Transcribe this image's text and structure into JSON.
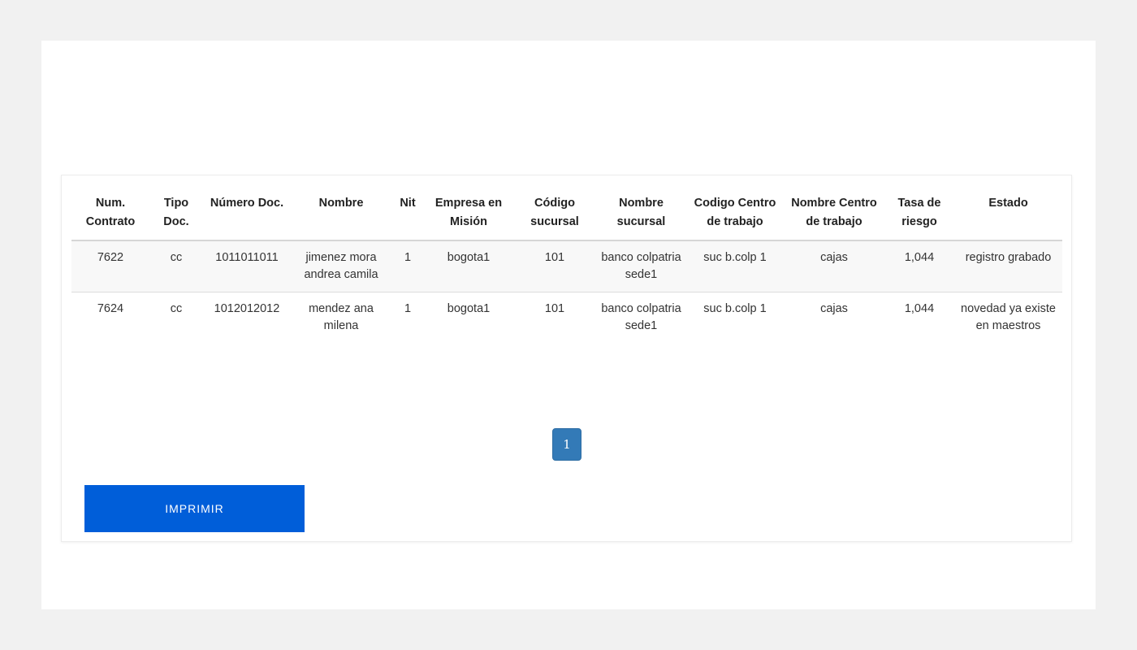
{
  "table": {
    "headers": [
      "Num. Contrato",
      "Tipo Doc.",
      "Número Doc.",
      "Nombre",
      "Nit",
      "Empresa en Misión",
      "Código sucursal",
      "Nombre sucursal",
      "Codigo Centro de trabajo",
      "Nombre Centro de trabajo",
      "Tasa de riesgo",
      "Estado"
    ],
    "rows": [
      [
        "7622",
        "cc",
        "1011011011",
        "jimenez mora andrea camila",
        "1",
        "bogota1",
        "101",
        "banco colpatria sede1",
        "suc b.colp 1",
        "cajas",
        "1,044",
        "registro grabado"
      ],
      [
        "7624",
        "cc",
        "1012012012",
        "mendez ana milena",
        "1",
        "bogota1",
        "101",
        "banco colpatria sede1",
        "suc b.colp 1",
        "cajas",
        "1,044",
        "novedad ya existe en maestros"
      ]
    ]
  },
  "pagination": {
    "current_page": "1"
  },
  "actions": {
    "print_label": "IMPRIMIR"
  },
  "colors": {
    "primary_button": "#005ed9",
    "pager_active": "#337ab7"
  }
}
